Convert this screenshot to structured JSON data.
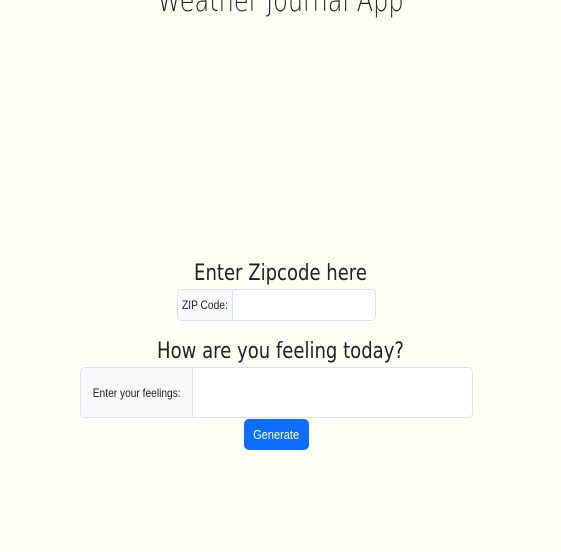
{
  "app": {
    "title": "Weather Journal App"
  },
  "zip_section": {
    "heading": "Enter Zipcode here",
    "label": "ZIP Code:",
    "value": "",
    "placeholder": ""
  },
  "feelings_section": {
    "heading": "How are you feeling today?",
    "label": "Enter your feelings:",
    "value": "",
    "placeholder": ""
  },
  "actions": {
    "generate_label": "Generate"
  },
  "colors": {
    "background": "#fffff6",
    "accent": "#0d6efd",
    "border": "#dee2e6",
    "label_bg": "#f8f9fa"
  }
}
